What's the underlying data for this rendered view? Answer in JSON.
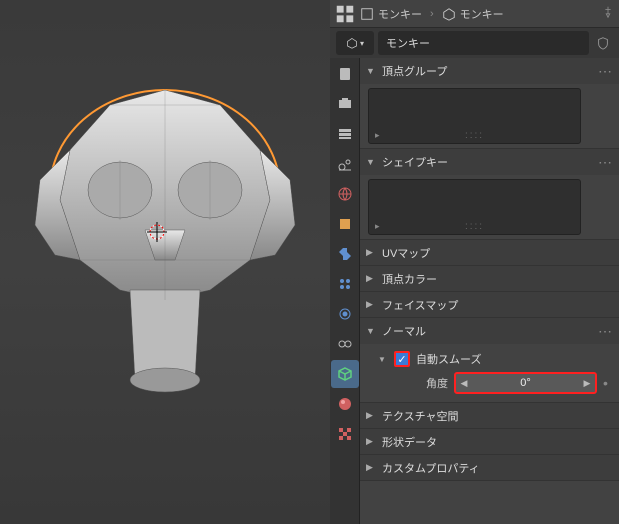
{
  "breadcrumb": {
    "item1": "モンキー",
    "item2": "モンキー"
  },
  "object_name": "モンキー",
  "sections": {
    "vertex_groups": {
      "title": "頂点グループ"
    },
    "shape_keys": {
      "title": "シェイプキー"
    },
    "uv_maps": {
      "title": "UVマップ"
    },
    "vertex_colors": {
      "title": "頂点カラー"
    },
    "face_maps": {
      "title": "フェイスマップ"
    },
    "normals": {
      "title": "ノーマル",
      "auto_smooth_label": "自動スムーズ",
      "auto_smooth_checked": true,
      "angle_label": "角度",
      "angle_value": "0°"
    },
    "texture_space": {
      "title": "テクスチャ空間"
    },
    "geometry_data": {
      "title": "形状データ"
    },
    "custom_props": {
      "title": "カスタムプロパティ"
    }
  },
  "viewport_object": "Suzanne (low-poly monkey)"
}
